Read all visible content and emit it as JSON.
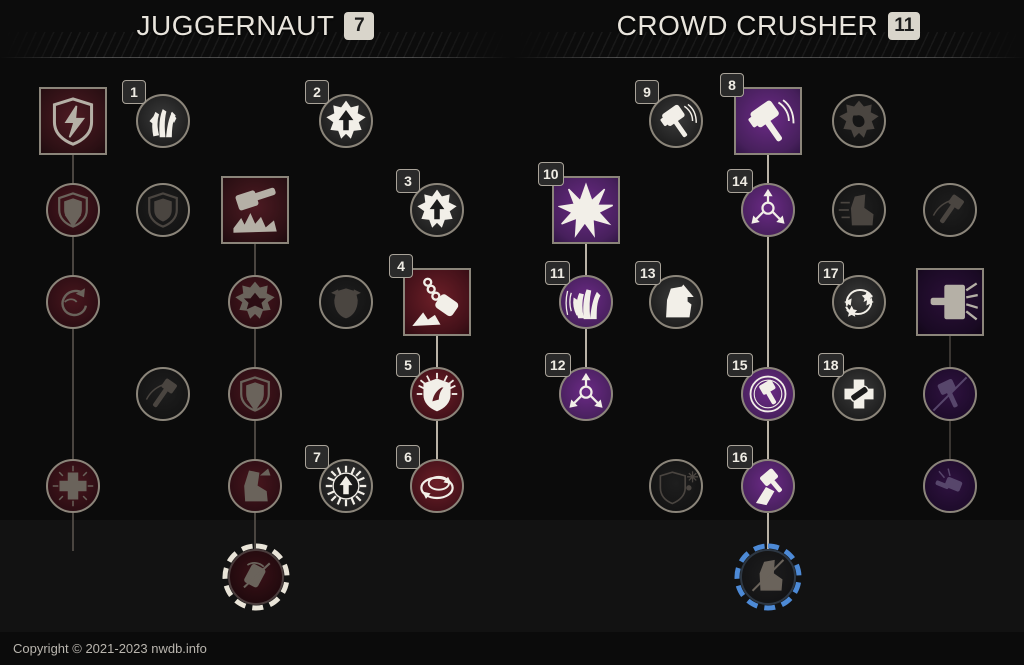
{
  "page": {
    "background_color": "#0b0b0b",
    "accent_selected": "#4b7fc4",
    "accent_red": "#6d1f28",
    "accent_purple": "#6b2a86"
  },
  "footer": {
    "copyright": "Copyright © 2021-2023 nwdb.info"
  },
  "trees": [
    {
      "id": "juggernaut",
      "title": "JUGGERNAUT",
      "points": "7",
      "ultimate": {
        "name": "ultimate-juggernaut",
        "state": "owned-red",
        "icon": "hammer-slam-icon"
      },
      "nodes": [
        {
          "rank": "",
          "icon": "shield-bash-icon",
          "shape": "square",
          "state": "selected-red",
          "frame": "blue",
          "col": 0,
          "row": 0
        },
        {
          "rank": "1",
          "icon": "hand-grip-icon",
          "shape": "circle",
          "state": "active-white",
          "frame": "bright",
          "col": 1,
          "row": 0
        },
        {
          "rank": "2",
          "icon": "star-arrow-up-icon",
          "shape": "circle",
          "state": "active-white",
          "frame": "bright",
          "col": 3,
          "row": 0
        },
        {
          "rank": "",
          "icon": "shield-down-icon",
          "shape": "circle",
          "state": "owned-red",
          "frame": "dim",
          "col": 0,
          "row": 1
        },
        {
          "rank": "",
          "icon": "shield-dark-icon",
          "shape": "circle",
          "state": "lock",
          "frame": "blue",
          "col": 1,
          "row": 1
        },
        {
          "rank": "",
          "icon": "hammer-ground-icon",
          "shape": "square",
          "state": "selected-red",
          "frame": "blue",
          "col": 2,
          "row": 1
        },
        {
          "rank": "3",
          "icon": "star-arrow-up-icon",
          "shape": "circle",
          "state": "active-white",
          "frame": "bright",
          "col": 4,
          "row": 1
        },
        {
          "rank": "",
          "icon": "swirl-arrow-icon",
          "shape": "circle",
          "state": "owned-red",
          "frame": "dim",
          "col": 0,
          "row": 2
        },
        {
          "rank": "",
          "icon": "gear-burst-icon",
          "shape": "circle",
          "state": "owned-red",
          "frame": "dim",
          "col": 2,
          "row": 2
        },
        {
          "rank": "",
          "icon": "chest-armor-icon",
          "shape": "circle",
          "state": "lock",
          "frame": "blue",
          "col": 3,
          "row": 2
        },
        {
          "rank": "4",
          "icon": "chain-flail-icon",
          "shape": "square",
          "state": "active-red",
          "frame": "bright",
          "col": 4,
          "row": 2
        },
        {
          "rank": "",
          "icon": "hammer-throw-icon",
          "shape": "circle",
          "state": "lock",
          "frame": "blue",
          "col": 1,
          "row": 3
        },
        {
          "rank": "",
          "icon": "shield-down-icon",
          "shape": "circle",
          "state": "owned-red",
          "frame": "dim",
          "col": 2,
          "row": 3
        },
        {
          "rank": "5",
          "icon": "shield-burst-icon",
          "shape": "circle",
          "state": "active-red",
          "frame": "bright",
          "col": 4,
          "row": 3
        },
        {
          "rank": "",
          "icon": "red-cross-icon",
          "shape": "circle",
          "state": "owned-red",
          "frame": "dim",
          "col": 0,
          "row": 4
        },
        {
          "rank": "",
          "icon": "boot-kick-icon",
          "shape": "circle",
          "state": "owned-red",
          "frame": "dim",
          "col": 2,
          "row": 4
        },
        {
          "rank": "7",
          "icon": "burst-arrow-up-icon",
          "shape": "circle",
          "state": "active-white",
          "frame": "bright",
          "col": 3,
          "row": 4
        },
        {
          "rank": "6",
          "icon": "orbit-ring-icon",
          "shape": "circle",
          "state": "active-red",
          "frame": "bright",
          "col": 4,
          "row": 4
        }
      ],
      "edges": [
        {
          "from": [
            0,
            0
          ],
          "to": [
            0,
            4
          ],
          "tone": "dim"
        },
        {
          "from": [
            2,
            1
          ],
          "to": [
            2,
            4
          ],
          "tone": "dim"
        },
        {
          "from": [
            4,
            2
          ],
          "to": [
            4,
            4
          ],
          "tone": "bright"
        },
        {
          "from": [
            0,
            4
          ],
          "to": "ultimate",
          "tone": "dim"
        },
        {
          "from": [
            2,
            4
          ],
          "to": "ultimate",
          "tone": "dim"
        }
      ]
    },
    {
      "id": "crowd-crusher",
      "title": "CROWD CRUSHER",
      "points": "11",
      "ultimate": {
        "name": "ultimate-crowd-crusher",
        "state": "lock",
        "icon": "boot-slash-icon"
      },
      "nodes": [
        {
          "rank": "9",
          "icon": "hammer-swing-icon",
          "shape": "circle",
          "state": "active-white",
          "frame": "bright",
          "col": 1,
          "row": 0
        },
        {
          "rank": "8",
          "icon": "hammer-swing-icon",
          "shape": "square",
          "state": "active-purple",
          "frame": "bright",
          "col": 2,
          "row": 0
        },
        {
          "rank": "",
          "icon": "gear-fist-icon",
          "shape": "circle",
          "state": "lock",
          "frame": "blue",
          "col": 3,
          "row": 0
        },
        {
          "rank": "10",
          "icon": "shockwave-burst-icon",
          "shape": "square",
          "state": "active-purple",
          "frame": "bright",
          "col": 0,
          "row": 1
        },
        {
          "rank": "14",
          "icon": "spread-arrows-icon",
          "shape": "circle",
          "state": "active-purple",
          "frame": "bright",
          "col": 2,
          "row": 1
        },
        {
          "rank": "",
          "icon": "boot-speed-icon",
          "shape": "circle",
          "state": "lock",
          "frame": "blue",
          "col": 3,
          "row": 1
        },
        {
          "rank": "",
          "icon": "hammer-throw-icon",
          "shape": "circle",
          "state": "lock",
          "frame": "blue",
          "col": 4,
          "row": 1
        },
        {
          "rank": "11",
          "icon": "open-hand-icon",
          "shape": "circle",
          "state": "active-purple",
          "frame": "bright",
          "col": 0,
          "row": 2
        },
        {
          "rank": "13",
          "icon": "boot-arrow-up-icon",
          "shape": "circle",
          "state": "active-white",
          "frame": "bright",
          "col": 1,
          "row": 2
        },
        {
          "rank": "17",
          "icon": "star-cycle-icon",
          "shape": "circle",
          "state": "active-white",
          "frame": "bright",
          "col": 3,
          "row": 2
        },
        {
          "rank": "",
          "icon": "hammer-pillar-icon",
          "shape": "square",
          "state": "selected-purple",
          "frame": "blue",
          "col": 4,
          "row": 2
        },
        {
          "rank": "12",
          "icon": "spread-arrows-icon",
          "shape": "circle",
          "state": "active-purple",
          "frame": "bright",
          "col": 0,
          "row": 3
        },
        {
          "rank": "15",
          "icon": "hammer-ring-icon",
          "shape": "circle",
          "state": "active-purple",
          "frame": "bright",
          "col": 2,
          "row": 3
        },
        {
          "rank": "18",
          "icon": "cross-bandage-icon",
          "shape": "circle",
          "state": "active-white",
          "frame": "bright",
          "col": 3,
          "row": 3
        },
        {
          "rank": "",
          "icon": "hammer-slash-icon",
          "shape": "circle",
          "state": "owned-purple",
          "frame": "dark",
          "col": 4,
          "row": 3
        },
        {
          "rank": "",
          "icon": "shield-frost-icon",
          "shape": "circle",
          "state": "lock",
          "frame": "blue",
          "col": 1,
          "row": 4
        },
        {
          "rank": "16",
          "icon": "hammer-uppercut-icon",
          "shape": "circle",
          "state": "active-purple",
          "frame": "bright",
          "col": 2,
          "row": 4
        },
        {
          "rank": "",
          "icon": "hammer-strike-icon",
          "shape": "circle",
          "state": "owned-purple",
          "frame": "dark",
          "col": 4,
          "row": 4
        }
      ],
      "edges": [
        {
          "from": [
            0,
            1
          ],
          "to": [
            0,
            3
          ],
          "tone": "bright"
        },
        {
          "from": [
            2,
            0
          ],
          "to": [
            2,
            4
          ],
          "tone": "bright"
        },
        {
          "from": [
            4,
            2
          ],
          "to": [
            4,
            4
          ],
          "tone": "dimmer"
        },
        {
          "from": [
            2,
            4
          ],
          "to": "ultimate",
          "tone": "bright"
        }
      ]
    }
  ]
}
